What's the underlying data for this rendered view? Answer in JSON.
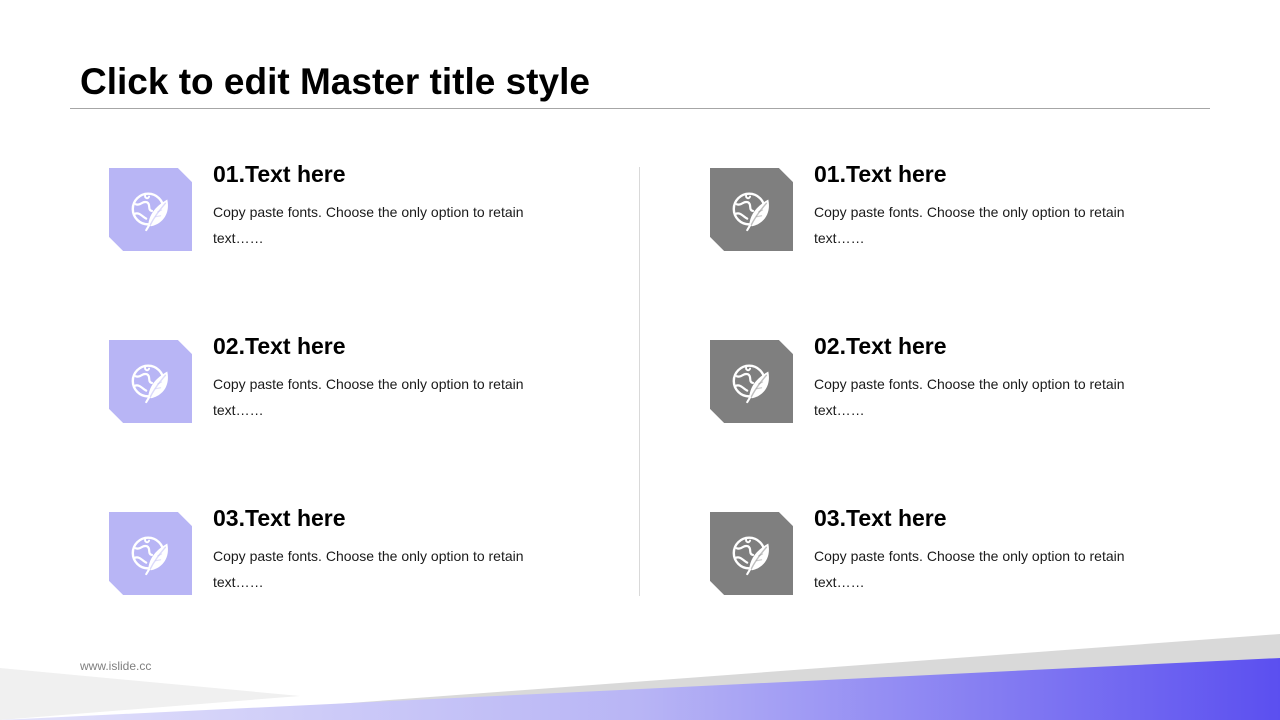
{
  "title": "Click to edit Master title style",
  "colors": {
    "accent_purple": "#b8b5f5",
    "accent_gray": "#7f7f7f",
    "gradient_end": "#5b4ff0"
  },
  "icon": "globe-leaf-icon",
  "left_items": [
    {
      "heading": "01.Text here",
      "body": "Copy paste fonts. Choose the only option to retain text……"
    },
    {
      "heading": "02.Text here",
      "body": "Copy paste fonts. Choose the only option to retain text……"
    },
    {
      "heading": "03.Text here",
      "body": "Copy paste fonts. Choose the only option to retain text……"
    }
  ],
  "right_items": [
    {
      "heading": "01.Text here",
      "body": "Copy paste fonts. Choose the only option to retain text……"
    },
    {
      "heading": "02.Text here",
      "body": "Copy paste fonts. Choose the only option to retain text……"
    },
    {
      "heading": "03.Text here",
      "body": "Copy paste fonts. Choose the only option to retain text……"
    }
  ],
  "footer": {
    "website": "www.islide.cc"
  }
}
